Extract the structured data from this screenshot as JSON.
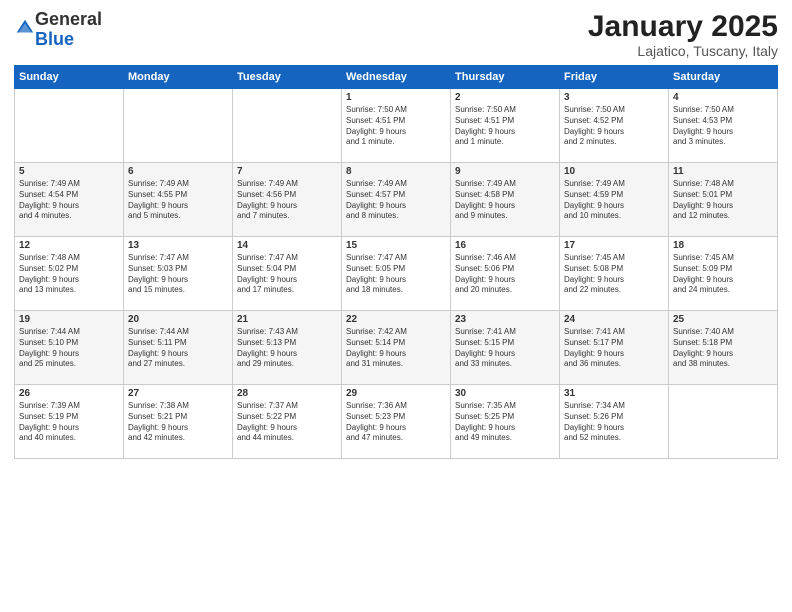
{
  "logo": {
    "general": "General",
    "blue": "Blue"
  },
  "title": "January 2025",
  "subtitle": "Lajatico, Tuscany, Italy",
  "headers": [
    "Sunday",
    "Monday",
    "Tuesday",
    "Wednesday",
    "Thursday",
    "Friday",
    "Saturday"
  ],
  "weeks": [
    [
      {
        "num": "",
        "info": ""
      },
      {
        "num": "",
        "info": ""
      },
      {
        "num": "",
        "info": ""
      },
      {
        "num": "1",
        "info": "Sunrise: 7:50 AM\nSunset: 4:51 PM\nDaylight: 9 hours\nand 1 minute."
      },
      {
        "num": "2",
        "info": "Sunrise: 7:50 AM\nSunset: 4:51 PM\nDaylight: 9 hours\nand 1 minute."
      },
      {
        "num": "3",
        "info": "Sunrise: 7:50 AM\nSunset: 4:52 PM\nDaylight: 9 hours\nand 2 minutes."
      },
      {
        "num": "4",
        "info": "Sunrise: 7:50 AM\nSunset: 4:53 PM\nDaylight: 9 hours\nand 3 minutes."
      }
    ],
    [
      {
        "num": "5",
        "info": "Sunrise: 7:49 AM\nSunset: 4:54 PM\nDaylight: 9 hours\nand 4 minutes."
      },
      {
        "num": "6",
        "info": "Sunrise: 7:49 AM\nSunset: 4:55 PM\nDaylight: 9 hours\nand 5 minutes."
      },
      {
        "num": "7",
        "info": "Sunrise: 7:49 AM\nSunset: 4:56 PM\nDaylight: 9 hours\nand 7 minutes."
      },
      {
        "num": "8",
        "info": "Sunrise: 7:49 AM\nSunset: 4:57 PM\nDaylight: 9 hours\nand 8 minutes."
      },
      {
        "num": "9",
        "info": "Sunrise: 7:49 AM\nSunset: 4:58 PM\nDaylight: 9 hours\nand 9 minutes."
      },
      {
        "num": "10",
        "info": "Sunrise: 7:49 AM\nSunset: 4:59 PM\nDaylight: 9 hours\nand 10 minutes."
      },
      {
        "num": "11",
        "info": "Sunrise: 7:48 AM\nSunset: 5:01 PM\nDaylight: 9 hours\nand 12 minutes."
      }
    ],
    [
      {
        "num": "12",
        "info": "Sunrise: 7:48 AM\nSunset: 5:02 PM\nDaylight: 9 hours\nand 13 minutes."
      },
      {
        "num": "13",
        "info": "Sunrise: 7:47 AM\nSunset: 5:03 PM\nDaylight: 9 hours\nand 15 minutes."
      },
      {
        "num": "14",
        "info": "Sunrise: 7:47 AM\nSunset: 5:04 PM\nDaylight: 9 hours\nand 17 minutes."
      },
      {
        "num": "15",
        "info": "Sunrise: 7:47 AM\nSunset: 5:05 PM\nDaylight: 9 hours\nand 18 minutes."
      },
      {
        "num": "16",
        "info": "Sunrise: 7:46 AM\nSunset: 5:06 PM\nDaylight: 9 hours\nand 20 minutes."
      },
      {
        "num": "17",
        "info": "Sunrise: 7:45 AM\nSunset: 5:08 PM\nDaylight: 9 hours\nand 22 minutes."
      },
      {
        "num": "18",
        "info": "Sunrise: 7:45 AM\nSunset: 5:09 PM\nDaylight: 9 hours\nand 24 minutes."
      }
    ],
    [
      {
        "num": "19",
        "info": "Sunrise: 7:44 AM\nSunset: 5:10 PM\nDaylight: 9 hours\nand 25 minutes."
      },
      {
        "num": "20",
        "info": "Sunrise: 7:44 AM\nSunset: 5:11 PM\nDaylight: 9 hours\nand 27 minutes."
      },
      {
        "num": "21",
        "info": "Sunrise: 7:43 AM\nSunset: 5:13 PM\nDaylight: 9 hours\nand 29 minutes."
      },
      {
        "num": "22",
        "info": "Sunrise: 7:42 AM\nSunset: 5:14 PM\nDaylight: 9 hours\nand 31 minutes."
      },
      {
        "num": "23",
        "info": "Sunrise: 7:41 AM\nSunset: 5:15 PM\nDaylight: 9 hours\nand 33 minutes."
      },
      {
        "num": "24",
        "info": "Sunrise: 7:41 AM\nSunset: 5:17 PM\nDaylight: 9 hours\nand 36 minutes."
      },
      {
        "num": "25",
        "info": "Sunrise: 7:40 AM\nSunset: 5:18 PM\nDaylight: 9 hours\nand 38 minutes."
      }
    ],
    [
      {
        "num": "26",
        "info": "Sunrise: 7:39 AM\nSunset: 5:19 PM\nDaylight: 9 hours\nand 40 minutes."
      },
      {
        "num": "27",
        "info": "Sunrise: 7:38 AM\nSunset: 5:21 PM\nDaylight: 9 hours\nand 42 minutes."
      },
      {
        "num": "28",
        "info": "Sunrise: 7:37 AM\nSunset: 5:22 PM\nDaylight: 9 hours\nand 44 minutes."
      },
      {
        "num": "29",
        "info": "Sunrise: 7:36 AM\nSunset: 5:23 PM\nDaylight: 9 hours\nand 47 minutes."
      },
      {
        "num": "30",
        "info": "Sunrise: 7:35 AM\nSunset: 5:25 PM\nDaylight: 9 hours\nand 49 minutes."
      },
      {
        "num": "31",
        "info": "Sunrise: 7:34 AM\nSunset: 5:26 PM\nDaylight: 9 hours\nand 52 minutes."
      },
      {
        "num": "",
        "info": ""
      }
    ]
  ]
}
